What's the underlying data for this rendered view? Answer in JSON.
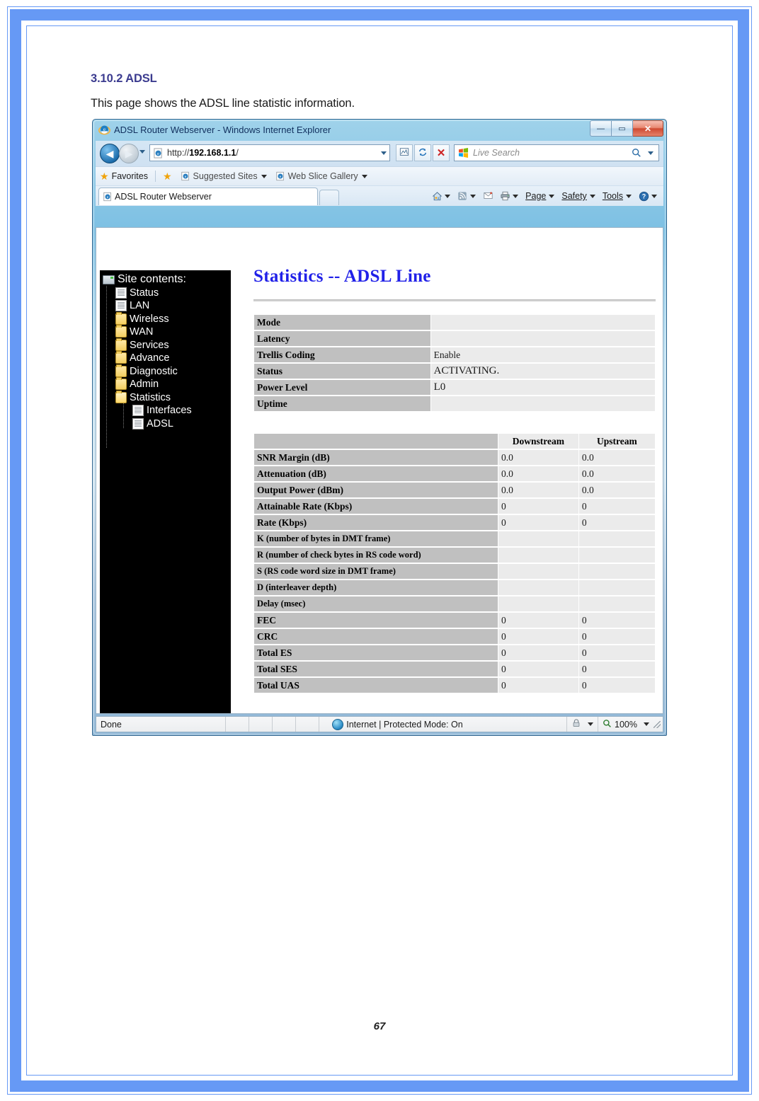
{
  "document": {
    "heading": "3.10.2 ADSL",
    "paragraph": "This page shows the ADSL line statistic information.",
    "page_number": "67",
    "frame_color": "#6699f5",
    "heading_color": "#3b3b8f"
  },
  "browser": {
    "title": "ADSL Router Webserver - Windows Internet Explorer",
    "window_controls": {
      "minimize": "—",
      "maximize": "▭",
      "close": "✕"
    },
    "address": {
      "prefix": "http://",
      "host": "192.168.1.1",
      "suffix": "/",
      "full": "http://192.168.1.1/"
    },
    "nav_buttons": {
      "back": "◀",
      "forward": "▶",
      "history_caret": "▾"
    },
    "nav_icons": {
      "compat": "🗟",
      "refresh": "↻",
      "stop": "✕"
    },
    "search": {
      "placeholder": "Live Search",
      "go": "🔍",
      "caret": "▾"
    },
    "favorites_bar": {
      "favorites_label": "Favorites",
      "suggested_sites": "Suggested Sites",
      "web_slice_gallery": "Web Slice Gallery"
    },
    "tab": {
      "label": "ADSL Router Webserver"
    },
    "command_bar": {
      "home": "🏠",
      "feeds": "📡",
      "mail": "✉",
      "print": "🖨",
      "page": "Page",
      "safety": "Safety",
      "tools": "Tools",
      "help": "?"
    },
    "status_bar": {
      "status": "Done",
      "zone": "Internet | Protected Mode: On",
      "zoom": "100%"
    }
  },
  "router_page": {
    "tree_root": "Site contents:",
    "tree_items": [
      {
        "label": "Status",
        "icon": "document-icon",
        "level": 1
      },
      {
        "label": "LAN",
        "icon": "document-icon",
        "level": 1
      },
      {
        "label": "Wireless",
        "icon": "folder-icon",
        "level": 1
      },
      {
        "label": "WAN",
        "icon": "folder-icon",
        "level": 1
      },
      {
        "label": "Services",
        "icon": "folder-icon",
        "level": 1
      },
      {
        "label": "Advance",
        "icon": "folder-icon",
        "level": 1
      },
      {
        "label": "Diagnostic",
        "icon": "folder-icon",
        "level": 1
      },
      {
        "label": "Admin",
        "icon": "folder-icon",
        "level": 1
      },
      {
        "label": "Statistics",
        "icon": "folder-open-icon",
        "level": 1
      },
      {
        "label": "Interfaces",
        "icon": "document-icon",
        "level": 2
      },
      {
        "label": "ADSL",
        "icon": "document-icon",
        "level": 2
      }
    ],
    "title": "Statistics -- ADSL Line",
    "title_color": "#2121e8",
    "info_table": [
      {
        "label": "Mode",
        "value": ""
      },
      {
        "label": "Latency",
        "value": ""
      },
      {
        "label": "Trellis Coding",
        "value": "Enable"
      },
      {
        "label": "Status",
        "value": "ACTIVATING."
      },
      {
        "label": "Power Level",
        "value": "L0"
      },
      {
        "label": "Uptime",
        "value": ""
      }
    ],
    "stats_table": {
      "headers": [
        "",
        "Downstream",
        "Upstream"
      ],
      "rows": [
        {
          "label": "SNR Margin (dB)",
          "downstream": "0.0",
          "upstream": "0.0"
        },
        {
          "label": "Attenuation (dB)",
          "downstream": "0.0",
          "upstream": "0.0"
        },
        {
          "label": "Output Power (dBm)",
          "downstream": "0.0",
          "upstream": "0.0"
        },
        {
          "label": "Attainable Rate (Kbps)",
          "downstream": "0",
          "upstream": "0"
        },
        {
          "label": "Rate (Kbps)",
          "downstream": "0",
          "upstream": "0"
        },
        {
          "label": "K (number of bytes in DMT frame)",
          "downstream": "",
          "upstream": ""
        },
        {
          "label": "R (number of check bytes in RS code word)",
          "downstream": "",
          "upstream": ""
        },
        {
          "label": "S (RS code word size in DMT frame)",
          "downstream": "",
          "upstream": ""
        },
        {
          "label": "D (interleaver depth)",
          "downstream": "",
          "upstream": ""
        },
        {
          "label": "Delay (msec)",
          "downstream": "",
          "upstream": ""
        },
        {
          "label": "FEC",
          "downstream": "0",
          "upstream": "0"
        },
        {
          "label": "CRC",
          "downstream": "0",
          "upstream": "0"
        },
        {
          "label": "Total ES",
          "downstream": "0",
          "upstream": "0"
        },
        {
          "label": "Total SES",
          "downstream": "0",
          "upstream": "0"
        },
        {
          "label": "Total UAS",
          "downstream": "0",
          "upstream": "0"
        }
      ]
    }
  }
}
